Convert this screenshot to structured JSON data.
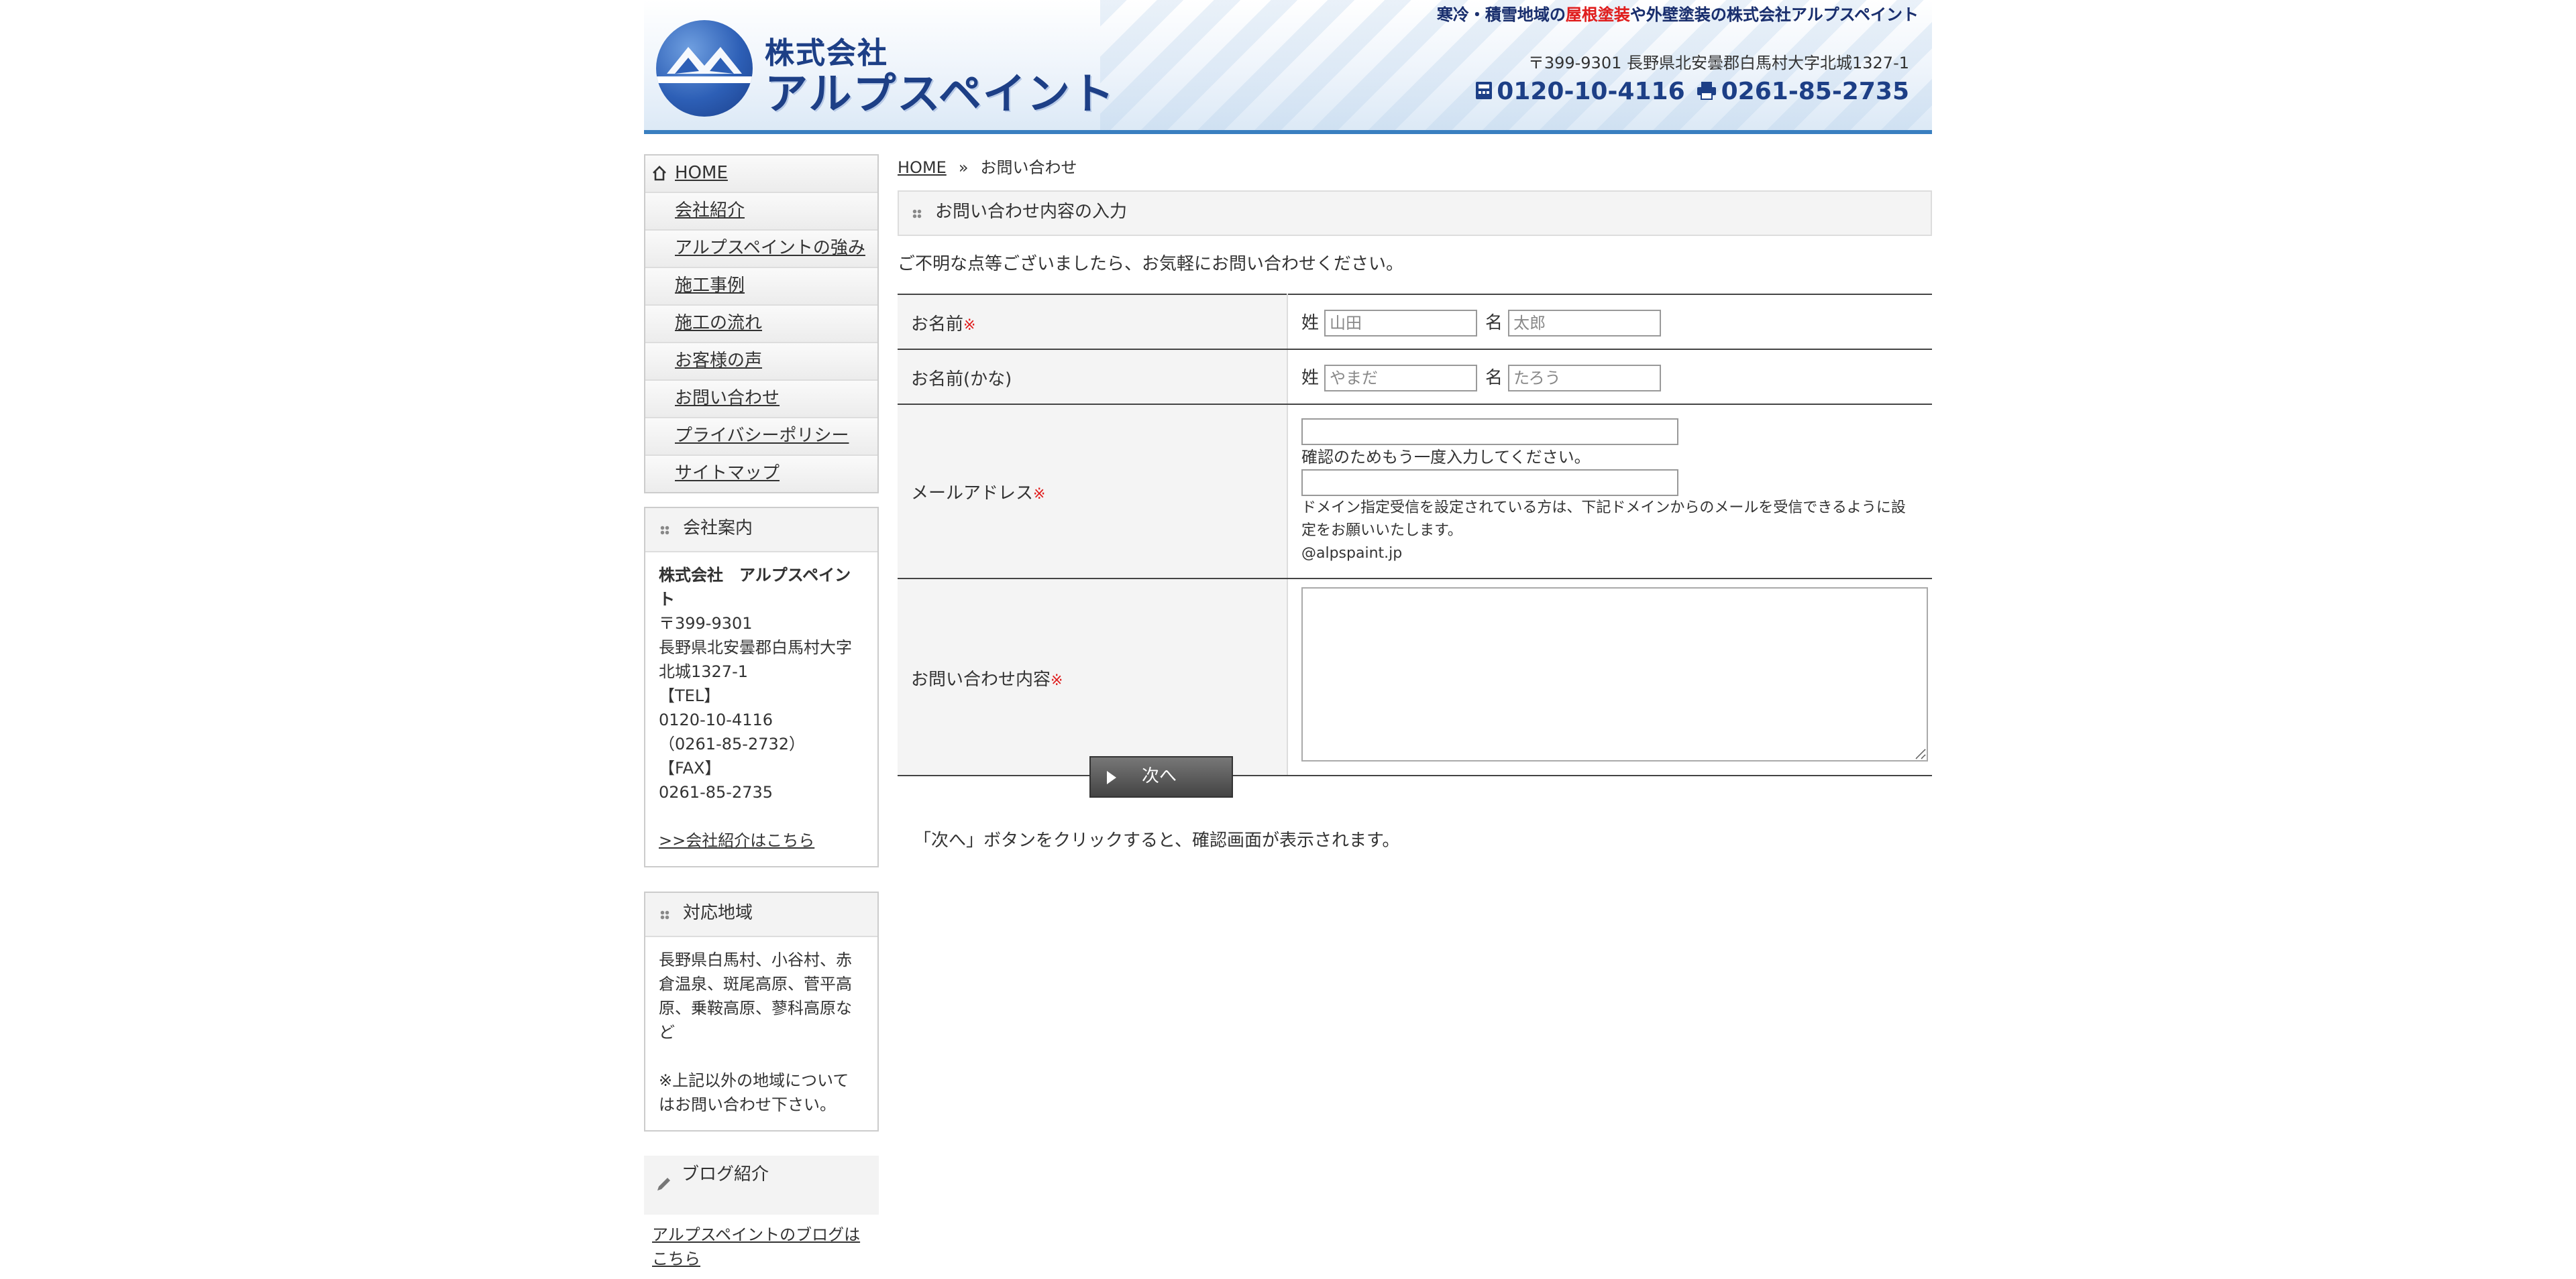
{
  "header": {
    "logo_line1": "株式会社",
    "logo_line2": "アルプスペイント",
    "tagline_a": "寒冷・積雪地域の",
    "tagline_red": "屋根塗装",
    "tagline_b": "や外壁塗装の株式会社アルプスペイント",
    "address": "〒399-9301 長野県北安曇郡白馬村大字北城1327-1",
    "tel": "0120-10-4116",
    "fax": "0261-85-2735"
  },
  "nav": [
    {
      "label": "HOME"
    },
    {
      "label": "会社紹介"
    },
    {
      "label": "アルプスペイントの強み"
    },
    {
      "label": "施工事例"
    },
    {
      "label": "施工の流れ"
    },
    {
      "label": "お客様の声"
    },
    {
      "label": "お問い合わせ"
    },
    {
      "label": "プライバシーポリシー"
    },
    {
      "label": "サイトマップ"
    }
  ],
  "company": {
    "heading": "会社案内",
    "name": "株式会社　アルプスペイント",
    "zip": "〒399-9301",
    "address": "長野県北安曇郡白馬村大字北城1327-1",
    "tel_label": "【TEL】",
    "tel": "0120-10-4116",
    "tel_sub": "（0261-85-2732）",
    "fax_label": "【FAX】",
    "fax": "0261-85-2735",
    "link": ">>会社紹介はこちら"
  },
  "area": {
    "heading": "対応地域",
    "text": "長野県白馬村、小谷村、赤倉温泉、斑尾高原、菅平高原、乗鞍高原、蓼科高原など",
    "note": "※上記以外の地域についてはお問い合わせ下さい。"
  },
  "blog": {
    "heading": "ブログ紹介",
    "link": "アルプスペイントのブログはこちら"
  },
  "breadcrumb": {
    "home": "HOME",
    "sep": "»",
    "current": "お問い合わせ"
  },
  "form": {
    "title": "お問い合わせ内容の入力",
    "intro": "ご不明な点等ございましたら、お気軽にお問い合わせください。",
    "required_mark": "※",
    "name_label": "お名前",
    "kana_label": "お名前(かな)",
    "sei": "姓",
    "mei": "名",
    "name_sei_placeholder": "山田",
    "name_mei_placeholder": "太郎",
    "kana_sei_placeholder": "やまだ",
    "kana_mei_placeholder": "たろう",
    "email_label": "メールアドレス",
    "email_confirm": "確認のためもう一度入力してください。",
    "email_note": "ドメイン指定受信を設定されている方は、下記ドメインからのメールを受信できるように設定をお願いいたします。",
    "email_domain": "@alpspaint.jp",
    "message_label": "お問い合わせ内容",
    "hint": "「次へ」ボタンをクリックすると、確認画面が表示されます。",
    "next_button": "次へ"
  }
}
